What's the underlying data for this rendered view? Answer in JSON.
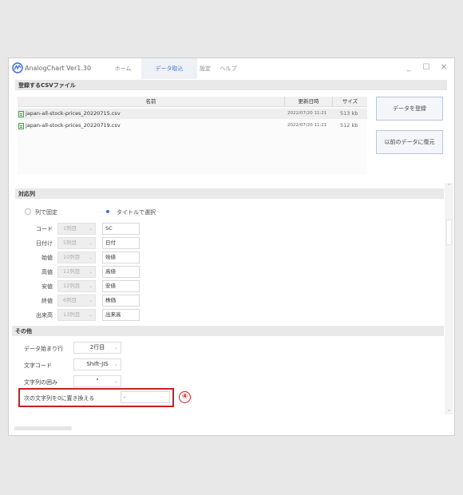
{
  "window": {
    "title": "AnalogChart Ver1.30",
    "menu": [
      "ホーム",
      "データ取込",
      "設定",
      "ヘルプ"
    ],
    "active_menu": "データ取込",
    "controls": {
      "minimize": "_",
      "maximize": "☐",
      "close": "✕"
    }
  },
  "files_section": {
    "header": "登録するCSVファイル",
    "columns": {
      "name": "名前",
      "updated": "更新日時",
      "size": "サイズ"
    },
    "rows": [
      {
        "name": "japan-all-stock-prices_20220715.csv",
        "updated": "2022/07/20 11:21",
        "size": "513 kb"
      },
      {
        "name": "japan-all-stock-prices_20220719.csv",
        "updated": "2022/07/20 11:21",
        "size": "512 kb"
      }
    ],
    "register_button": "データを登録",
    "restore_button": "以前のデータに復元"
  },
  "mapping_section": {
    "header": "対応列",
    "mode_fixed": "列で固定",
    "mode_title": "タイトルで選択",
    "selected_mode": "title",
    "fields": [
      {
        "label": "コード",
        "column": "1列目",
        "title": "SC"
      },
      {
        "label": "日付け",
        "column": "5列目",
        "title": "日付"
      },
      {
        "label": "始値",
        "column": "10列目",
        "title": "始値"
      },
      {
        "label": "高値",
        "column": "11列目",
        "title": "高値"
      },
      {
        "label": "安値",
        "column": "12列目",
        "title": "安値"
      },
      {
        "label": "終値",
        "column": "6列目",
        "title": "株価"
      },
      {
        "label": "出来高",
        "column": "13列目",
        "title": "出来高"
      }
    ]
  },
  "other_section": {
    "header": "その他",
    "start_row_label": "データ始まり行",
    "start_row_value": "2行目",
    "encoding_label": "文字コード",
    "encoding_value": "Shift-JIS",
    "quote_label": "文字列の囲み",
    "quote_value": "\"",
    "replace_label": "次の文字列を0に置き換える",
    "replace_value": "-"
  },
  "annotation": {
    "marker": "④",
    "color": "#cc1f1f"
  },
  "colors": {
    "accent": "#3a6fd8",
    "active_tab": "#4a7fc1"
  }
}
